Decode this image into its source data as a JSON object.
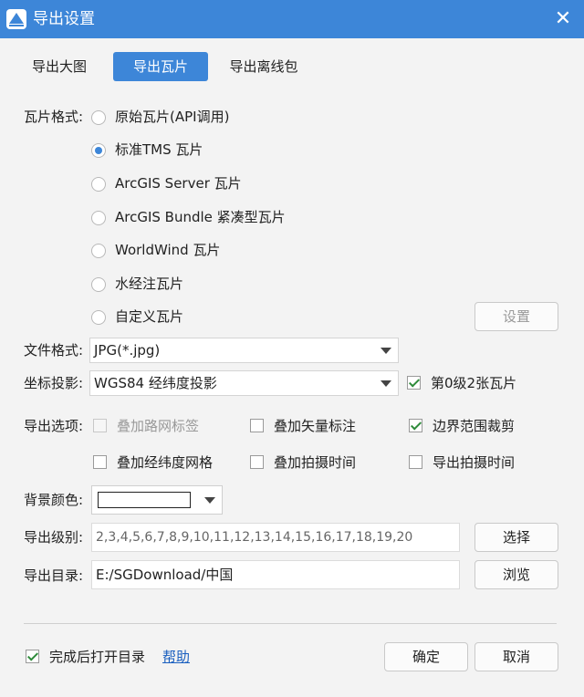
{
  "window": {
    "title": "导出设置",
    "close_glyph": "✕"
  },
  "tabs": [
    {
      "label": "导出大图",
      "active": false
    },
    {
      "label": "导出瓦片",
      "active": true
    },
    {
      "label": "导出离线包",
      "active": false
    }
  ],
  "tile_format": {
    "label": "瓦片格式:",
    "options": [
      {
        "label": "原始瓦片(API调用)",
        "checked": false
      },
      {
        "label": "标准TMS 瓦片",
        "checked": true
      },
      {
        "label": "ArcGIS Server 瓦片",
        "checked": false
      },
      {
        "label": "ArcGIS Bundle 紧凑型瓦片",
        "checked": false
      },
      {
        "label": "WorldWind 瓦片",
        "checked": false
      },
      {
        "label": "水经注瓦片",
        "checked": false
      },
      {
        "label": "自定义瓦片",
        "checked": false
      }
    ],
    "settings_button": "设置"
  },
  "file_format": {
    "label": "文件格式:",
    "value": "JPG(*.jpg)"
  },
  "projection": {
    "label": "坐标投影:",
    "value": "WGS84 经纬度投影",
    "level0_checkbox": {
      "label": "第0级2张瓦片",
      "checked": true
    }
  },
  "export_options": {
    "label": "导出选项:",
    "items": [
      {
        "label": "叠加路网标签",
        "checked": false,
        "disabled": true
      },
      {
        "label": "叠加矢量标注",
        "checked": false,
        "disabled": false
      },
      {
        "label": "边界范围裁剪",
        "checked": true,
        "disabled": false
      },
      {
        "label": "叠加经纬度网格",
        "checked": false,
        "disabled": false
      },
      {
        "label": "叠加拍摄时间",
        "checked": false,
        "disabled": false
      },
      {
        "label": "导出拍摄时间",
        "checked": false,
        "disabled": false
      }
    ]
  },
  "background_color": {
    "label": "背景颜色:",
    "value_color": "#ffffff"
  },
  "export_levels": {
    "label": "导出级别:",
    "value": "2,3,4,5,6,7,8,9,10,11,12,13,14,15,16,17,18,19,20",
    "button": "选择"
  },
  "export_dir": {
    "label": "导出目录:",
    "value": "E:/SGDownload/中国",
    "button": "浏览"
  },
  "footer": {
    "open_dir_checkbox": {
      "label": "完成后打开目录",
      "checked": true
    },
    "help_link": "帮助",
    "ok_button": "确定",
    "cancel_button": "取消"
  },
  "colors": {
    "accent": "#3d86d8",
    "check_green": "#2e8b3a"
  }
}
